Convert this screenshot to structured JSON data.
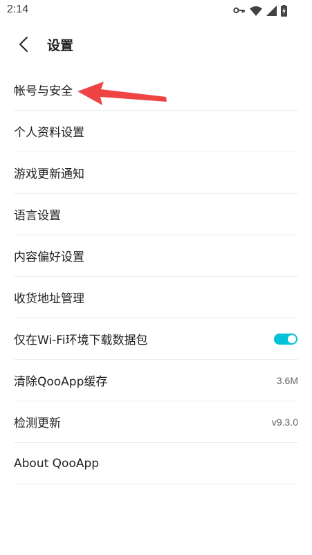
{
  "status_bar": {
    "time": "2:14",
    "icons": [
      "vpn-key-icon",
      "wifi-icon",
      "cellular-signal-icon",
      "battery-charging-icon"
    ]
  },
  "header": {
    "title": "设置",
    "back_icon": "back-arrow-icon"
  },
  "settings": {
    "items": [
      {
        "label": "帐号与安全"
      },
      {
        "label": "个人资料设置"
      },
      {
        "label": "游戏更新通知"
      },
      {
        "label": "语言设置"
      },
      {
        "label": "内容偏好设置"
      },
      {
        "label": "收货地址管理"
      },
      {
        "label": "仅在Wi-Fi环境下载数据包",
        "toggle_on": true
      },
      {
        "label": "清除QooApp缓存",
        "value": "3.6M"
      },
      {
        "label": "检测更新",
        "value": "v9.3.0"
      },
      {
        "label": "About QooApp"
      }
    ]
  },
  "colors": {
    "toggle_accent": "#00c2d9",
    "annotation_arrow": "#ef4444",
    "divider": "#eeeeee"
  }
}
